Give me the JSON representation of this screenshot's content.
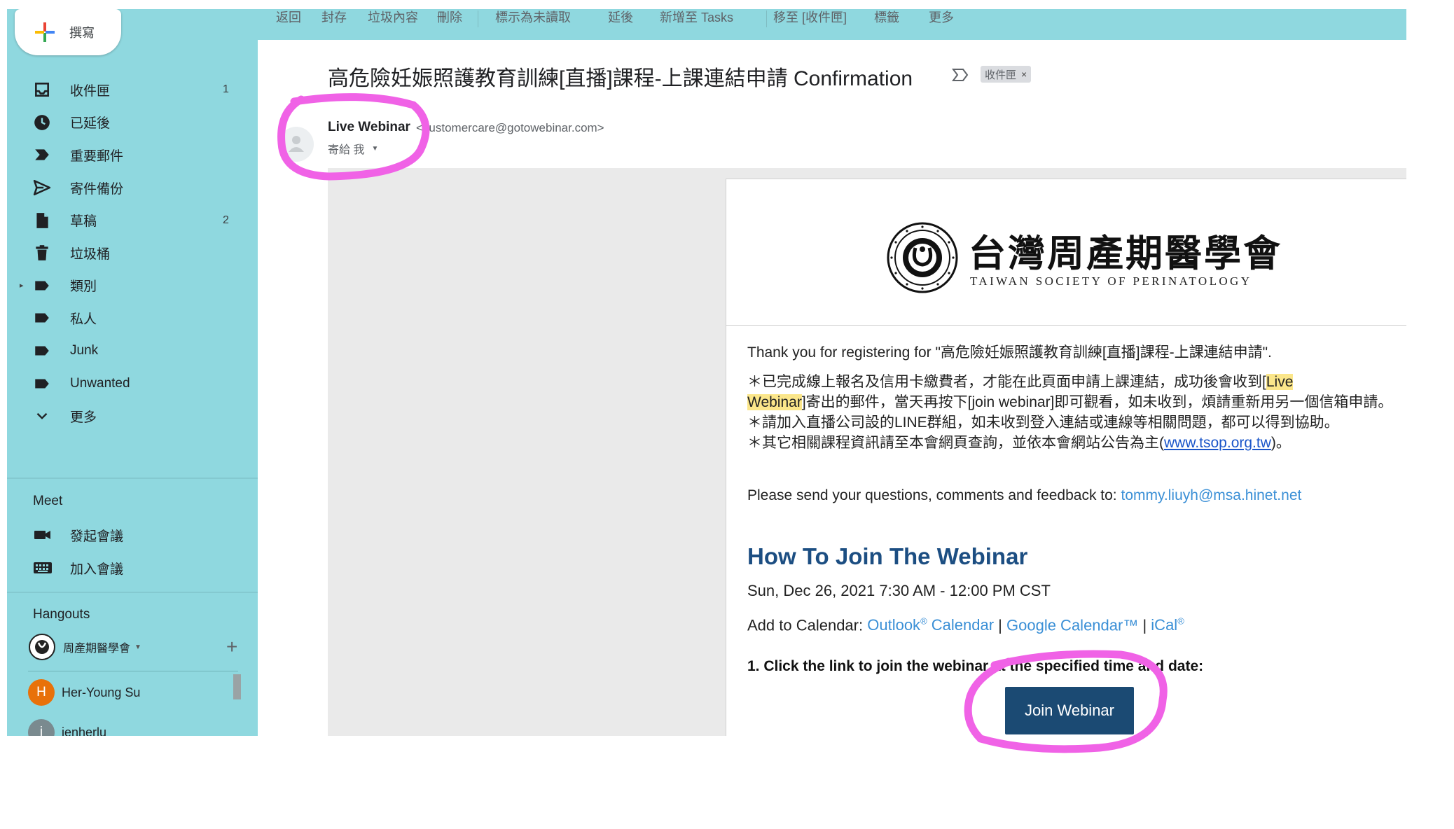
{
  "sidebar": {
    "compose_label": "撰寫",
    "nav": [
      {
        "label": "收件匣",
        "count": "1",
        "icon": "inbox-icon"
      },
      {
        "label": "已延後",
        "count": "",
        "icon": "clock-icon"
      },
      {
        "label": "重要郵件",
        "count": "",
        "icon": "important-icon"
      },
      {
        "label": "寄件備份",
        "count": "",
        "icon": "send-icon"
      },
      {
        "label": "草稿",
        "count": "2",
        "icon": "draft-icon"
      },
      {
        "label": "垃圾桶",
        "count": "",
        "icon": "trash-icon"
      },
      {
        "label": "類別",
        "count": "",
        "icon": "label-icon"
      },
      {
        "label": "私人",
        "count": "",
        "icon": "label-icon"
      },
      {
        "label": "Junk",
        "count": "",
        "icon": "label-icon"
      },
      {
        "label": "Unwanted",
        "count": "",
        "icon": "label-icon"
      },
      {
        "label": "更多",
        "count": "",
        "icon": "chevron-down-icon"
      }
    ],
    "meet": {
      "title": "Meet",
      "start": "發起會議",
      "join": "加入會議"
    },
    "hangouts": {
      "title": "Hangouts",
      "account": "周產期醫學會",
      "contacts": [
        {
          "initial": "H",
          "name": "Her-Young Su",
          "color": "#e8710a"
        },
        {
          "initial": "j",
          "name": "jenherlu",
          "color": "#7a8a8f"
        }
      ]
    }
  },
  "toolbar": {
    "items": [
      "返回",
      "封存",
      "垃圾內容",
      "刪除",
      "標示為未讀取",
      "延後",
      "新增至 Tasks",
      "移至 [收件匣]",
      "標籤",
      "更多"
    ]
  },
  "email": {
    "subject": "高危險妊娠照護教育訓練[直播]課程-上課連結申請 Confirmation",
    "label_chip": "收件匣",
    "sender_name": "Live Webinar",
    "sender_email": "<customercare@gotowebinar.com>",
    "to_me": "寄給 我",
    "logo_cn": "台灣周產期醫學會",
    "logo_en": "TAIWAN SOCIETY OF PERINATOLOGY",
    "thanks": "Thank you for registering for \"高危險妊娠照護教育訓練[直播]課程-上課連結申請\".",
    "note1_pre": "＊已完成線上報名及信用卡繳費者，才能在此頁面申請上課連結，成功後會收到[",
    "note1_hl1": "Live",
    "note1_hl2": "Webinar",
    "note1_post": "]寄出的郵件，當天再按下[join webinar]即可觀看，如未收到，煩請重新用另一個信箱申請。",
    "note2": "＊請加入直播公司設的LINE群組，如未收到登入連結或連線等相關問題，都可以得到協助。",
    "note3_pre": "＊其它相關課程資訊請至本會網頁查詢，並依本會網站公告為主(",
    "note3_link": "www.tsop.org.tw",
    "note3_post": ")。",
    "questions_pre": "Please send your questions, comments and feedback to: ",
    "questions_email": "tommy.liuyh@msa.hinet.net",
    "join_title": "How To Join The Webinar",
    "date_line": "Sun, Dec 26, 2021 7:30 AM - 12:00 PM CST",
    "cal_prefix": "Add to Calendar: ",
    "cal_outlook": "Outlook",
    "cal_outlook_cal": " Calendar",
    "cal_sep": " | ",
    "cal_google": "Google Calendar™",
    "cal_ical": "iCal",
    "reg_mark": "®",
    "step1": "1. Click the link to join the webinar at the specified time and date:",
    "join_button": "Join Webinar"
  },
  "colors": {
    "sidebar_bg": "#8fd8df",
    "join_button": "#1b4a73",
    "heading": "#1c4e82",
    "annotation": "#f062e6"
  }
}
